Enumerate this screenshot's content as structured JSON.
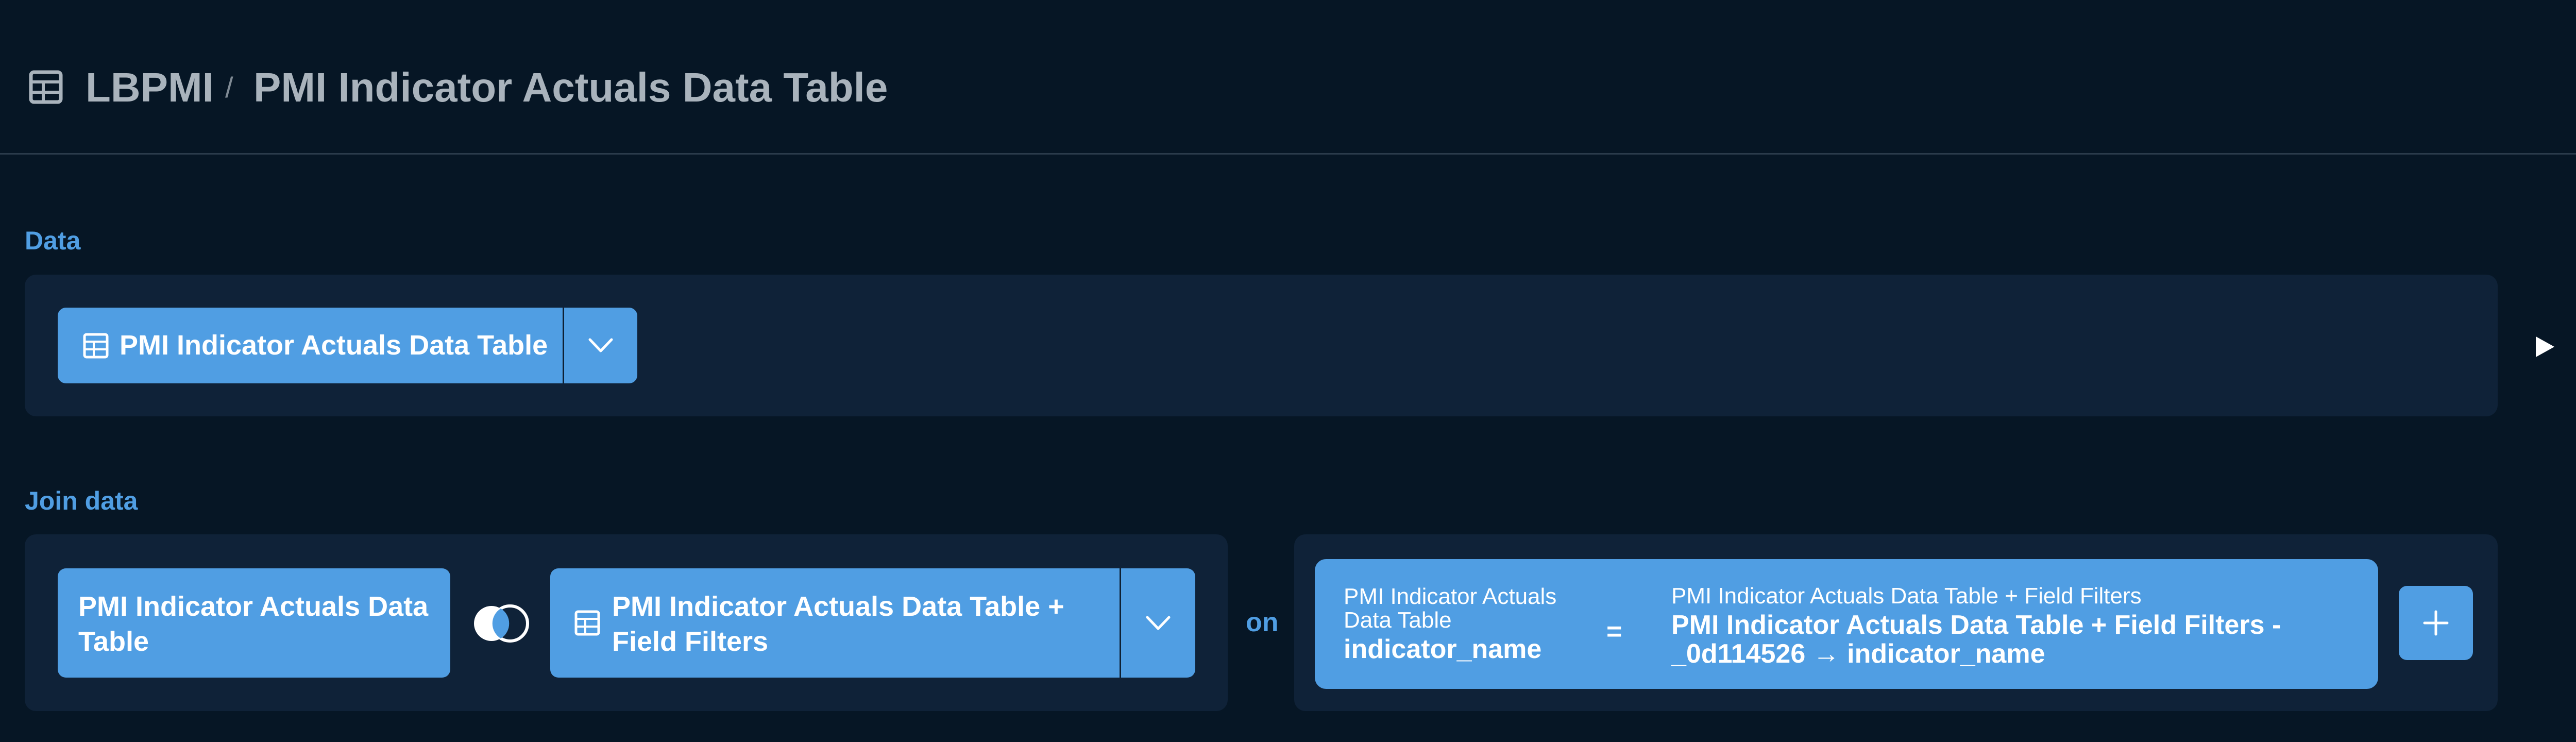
{
  "breadcrumb": {
    "icon": "table-icon",
    "database": "LBPMI",
    "separator": "/",
    "table": "PMI Indicator Actuals Data Table"
  },
  "data_section": {
    "label": "Data",
    "source_table": "PMI Indicator Actuals Data Table",
    "run_icon": "play-icon"
  },
  "join_section": {
    "label": "Join data",
    "left_table": "PMI Indicator Actuals Data Table",
    "join_type_icon": "join-left-outer-icon",
    "right_table": "PMI Indicator Actuals Data Table + Field Filters",
    "on_label": "on",
    "condition": {
      "left_source": "PMI Indicator Actuals Data Table",
      "left_field": "indicator_name",
      "operator": "=",
      "right_source": "PMI Indicator Actuals Data Table + Field Filters",
      "right_field": "PMI Indicator Actuals Data Table + Field Filters - _0d114526 → indicator_name"
    },
    "add_icon": "plus-icon"
  },
  "colors": {
    "background": "#061625",
    "panel": "#0f2238",
    "accent": "#509ee3",
    "breadcrumb_text": "#a9b3bc"
  }
}
